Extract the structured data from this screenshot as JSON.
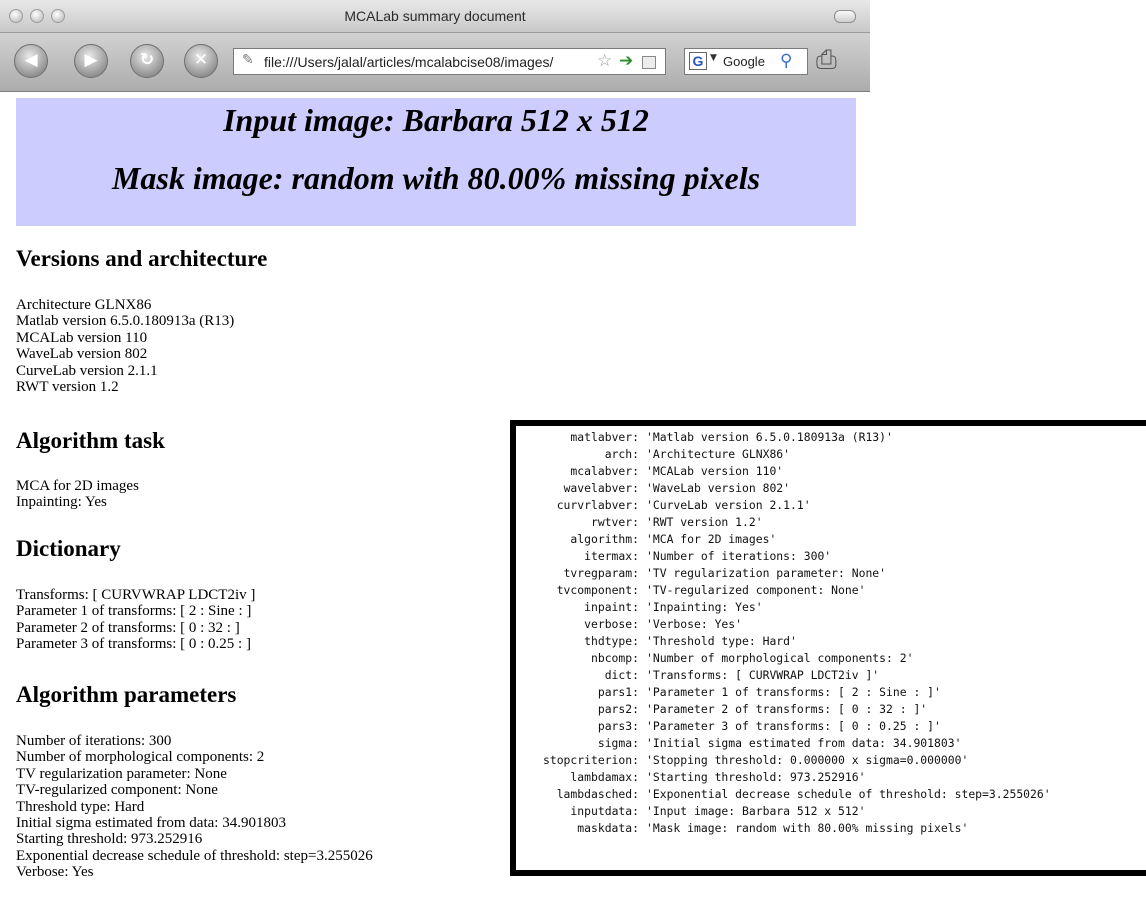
{
  "window": {
    "title": "MCALab summary document",
    "url": "file:///Users/jalal/articles/mcalabcise08/images/",
    "search_engine": "Google"
  },
  "icons": {
    "back": "back-arrow-icon",
    "forward": "forward-arrow-icon",
    "reload": "reload-icon",
    "stop": "stop-icon",
    "bookmark": "star-icon",
    "go": "go-arrow-icon",
    "feed": "feed-icon",
    "search": "magnifier-icon",
    "print": "print-icon"
  },
  "banner": {
    "line1": "Input image: Barbara 512 x 512",
    "line2": "Mask image: random with 80.00% missing pixels"
  },
  "sections": {
    "versions": {
      "heading": "Versions and architecture",
      "lines": [
        "Architecture GLNX86",
        "Matlab version 6.5.0.180913a (R13)",
        "MCALab version 110",
        "WaveLab version 802",
        "CurveLab version 2.1.1",
        "RWT version 1.2"
      ]
    },
    "task": {
      "heading": "Algorithm task",
      "lines": [
        "MCA for 2D images",
        "Inpainting: Yes"
      ]
    },
    "dictionary": {
      "heading": "Dictionary",
      "lines": [
        "Transforms: [ CURVWRAP LDCT2iv ]",
        "Parameter 1 of transforms: [ 2 : Sine : ]",
        "Parameter 2 of transforms: [ 0 : 32 : ]",
        "Parameter 3 of transforms: [ 0 : 0.25 : ]"
      ]
    },
    "parameters": {
      "heading": "Algorithm parameters",
      "lines": [
        "Number of iterations: 300",
        "Number of morphological components: 2",
        "TV regularization parameter: None",
        "TV-regularized component: None",
        "Threshold type: Hard",
        "Initial sigma estimated from data: 34.901803",
        "Starting threshold: 973.252916",
        "Exponential decrease schedule of threshold: step=3.255026",
        "Verbose: Yes"
      ]
    }
  },
  "console": {
    "rows": [
      {
        "key": "matlabver:",
        "value": "'Matlab version 6.5.0.180913a (R13)'"
      },
      {
        "key": "arch:",
        "value": "'Architecture GLNX86'"
      },
      {
        "key": "mcalabver:",
        "value": "'MCALab version 110'"
      },
      {
        "key": "wavelabver:",
        "value": "'WaveLab version 802'"
      },
      {
        "key": "curvrlabver:",
        "value": "'CurveLab version 2.1.1'"
      },
      {
        "key": "rwtver:",
        "value": "'RWT version 1.2'"
      },
      {
        "key": "algorithm:",
        "value": "'MCA for 2D images'"
      },
      {
        "key": "itermax:",
        "value": "'Number of iterations: 300'"
      },
      {
        "key": "tvregparam:",
        "value": "'TV regularization parameter: None'"
      },
      {
        "key": "tvcomponent:",
        "value": "'TV-regularized component: None'"
      },
      {
        "key": "inpaint:",
        "value": "'Inpainting: Yes'"
      },
      {
        "key": "verbose:",
        "value": "'Verbose: Yes'"
      },
      {
        "key": "thdtype:",
        "value": "'Threshold type: Hard'"
      },
      {
        "key": "nbcomp:",
        "value": "'Number of morphological components: 2'"
      },
      {
        "key": "dict:",
        "value": "'Transforms: [ CURVWRAP LDCT2iv ]'"
      },
      {
        "key": "pars1:",
        "value": "'Parameter 1 of transforms: [ 2 : Sine : ]'"
      },
      {
        "key": "pars2:",
        "value": "'Parameter 2 of transforms: [ 0 : 32 : ]'"
      },
      {
        "key": "pars3:",
        "value": "'Parameter 3 of transforms: [ 0 : 0.25 : ]'"
      },
      {
        "key": "sigma:",
        "value": "'Initial sigma estimated from data: 34.901803'"
      },
      {
        "key": "stopcriterion:",
        "value": "'Stopping threshold: 0.000000 x sigma=0.000000'"
      },
      {
        "key": "lambdamax:",
        "value": "'Starting threshold: 973.252916'"
      },
      {
        "key": "lambdasched:",
        "value": "'Exponential decrease schedule of threshold: step=3.255026'"
      },
      {
        "key": "inputdata:",
        "value": "'Input image: Barbara 512 x 512'"
      },
      {
        "key": "maskdata:",
        "value": "'Mask image: random with 80.00% missing pixels'"
      }
    ]
  }
}
